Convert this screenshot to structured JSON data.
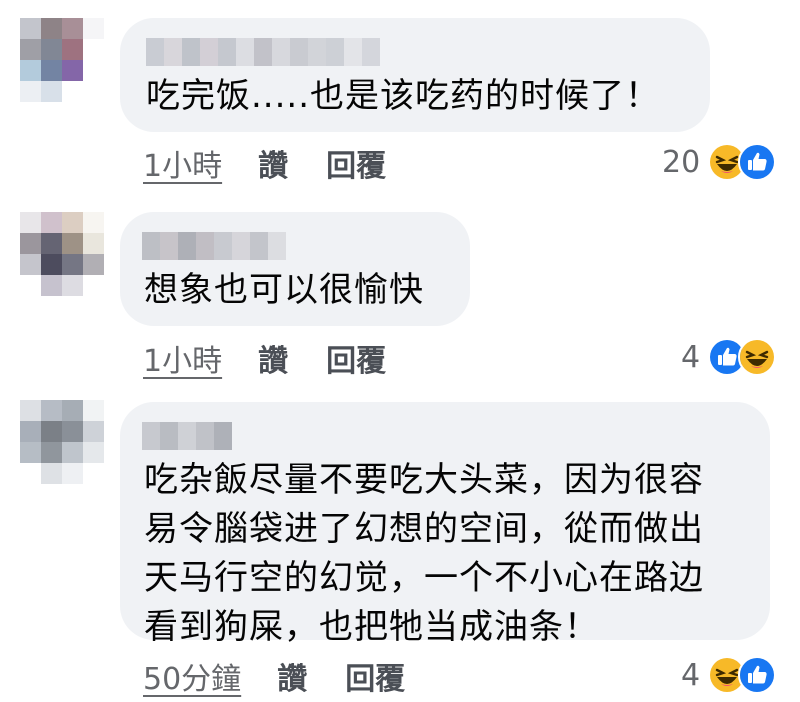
{
  "comments": [
    {
      "text": "吃完饭.....也是该吃药的时候了！",
      "time": "1小時",
      "like_label": "讚",
      "reply_label": "回覆",
      "reaction_count": "20",
      "reactions": [
        "haha-icon",
        "like-icon"
      ]
    },
    {
      "text": "想象也可以很愉快",
      "time": "1小時",
      "like_label": "讚",
      "reply_label": "回覆",
      "reaction_count": "4",
      "reactions": [
        "like-icon",
        "haha-icon"
      ]
    },
    {
      "text": "吃杂飯尽量不要吃大头菜，因为很容\n易令腦袋进了幻想的空间，從而做出\n天马行空的幻觉，一个不小心在路边\n看到狗屎，也把牠当成油条！",
      "time": "50分鐘",
      "like_label": "讚",
      "reply_label": "回覆",
      "reaction_count": "4",
      "reactions": [
        "haha-icon",
        "like-icon"
      ]
    }
  ],
  "colors": {
    "bubble": "#f0f2f5",
    "text": "#050505",
    "meta": "#65676b",
    "like_blue": "#1877f2",
    "haha_yellow": "#f7b928"
  }
}
